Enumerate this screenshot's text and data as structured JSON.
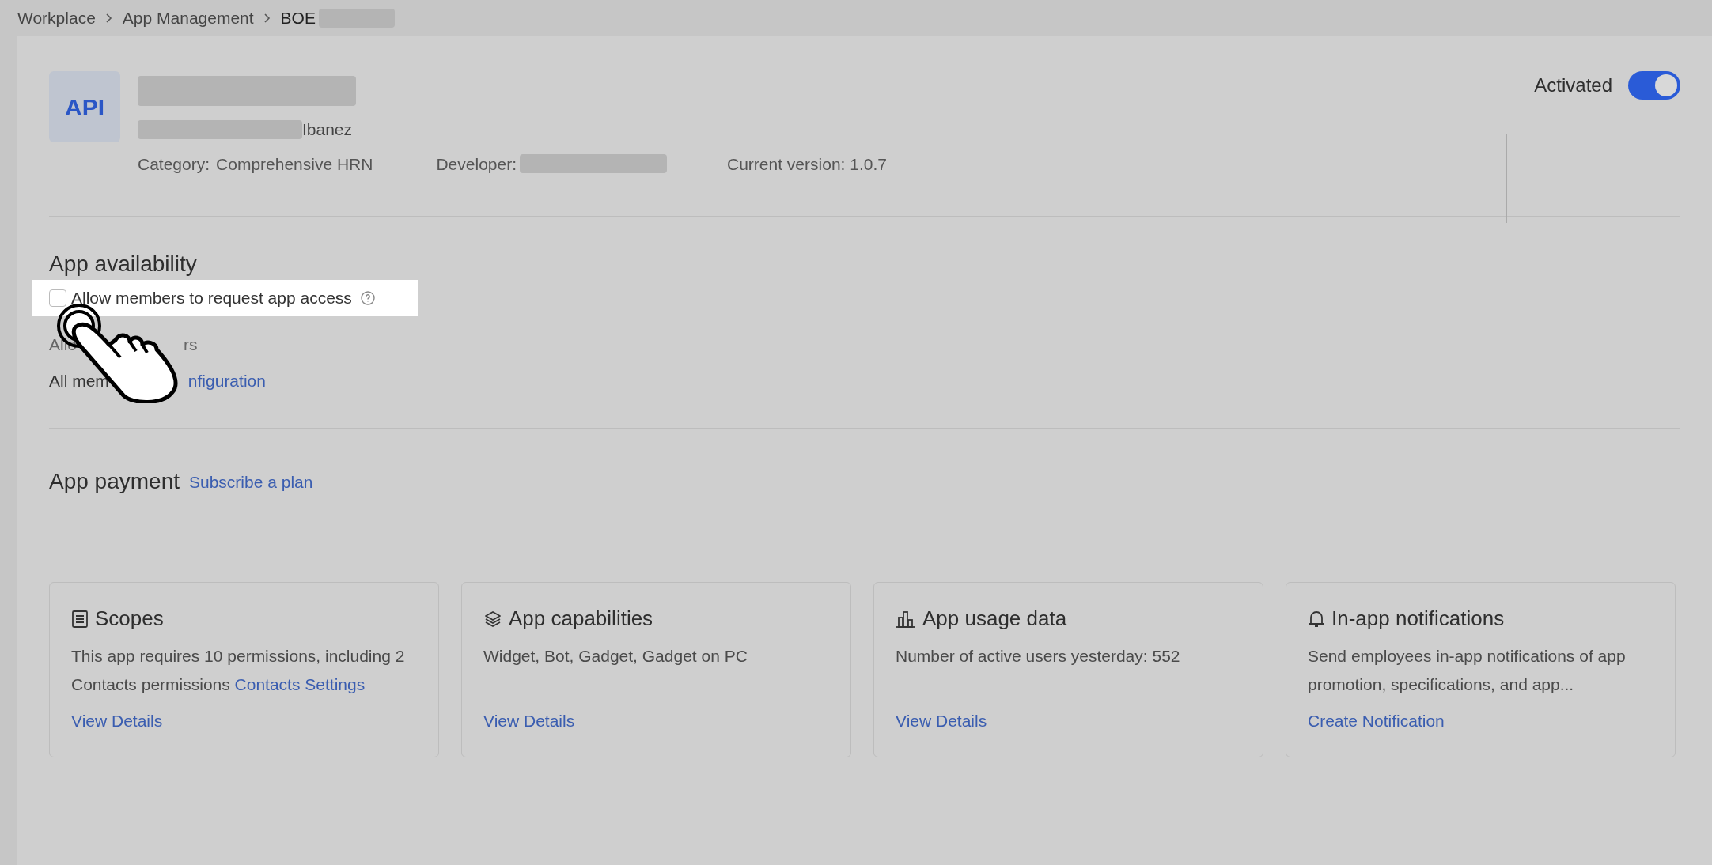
{
  "breadcrumb": [
    "Workplace",
    "App Management",
    "BOE"
  ],
  "app": {
    "logo": "API",
    "owner_suffix": "Ibanez",
    "category_label": "Category:",
    "category": "Comprehensive HRN",
    "developer_label": "Developer:",
    "version": "Current version: 1.0.7"
  },
  "activation": {
    "label": "Activated",
    "on": true
  },
  "availability": {
    "title": "App availability",
    "checkbox": {
      "label": "Allow members to request app access",
      "checked": false
    },
    "allowed_label_start": "Allo",
    "allowed_label_end": "rs",
    "scope_start": "All mem",
    "scope_link": "nfiguration"
  },
  "payment": {
    "title": "App payment",
    "link": "Subscribe a plan"
  },
  "cards": [
    {
      "kind": "scopes",
      "title": "Scopes",
      "text": "This app requires 10 permissions, including 2 Contacts permissions",
      "inline_link": "Contacts Settings",
      "link": "View Details"
    },
    {
      "kind": "capabilities",
      "title": "App capabilities",
      "text": "Widget, Bot, Gadget, Gadget on PC",
      "link": "View Details"
    },
    {
      "kind": "usage",
      "title": "App usage data",
      "text": "Number of active users yesterday: 552",
      "link": "View Details"
    },
    {
      "kind": "notifications",
      "title": "In-app notifications",
      "text": "Send employees in-app notifications of app promotion, specifications, and app...",
      "link": "Create Notification"
    }
  ]
}
